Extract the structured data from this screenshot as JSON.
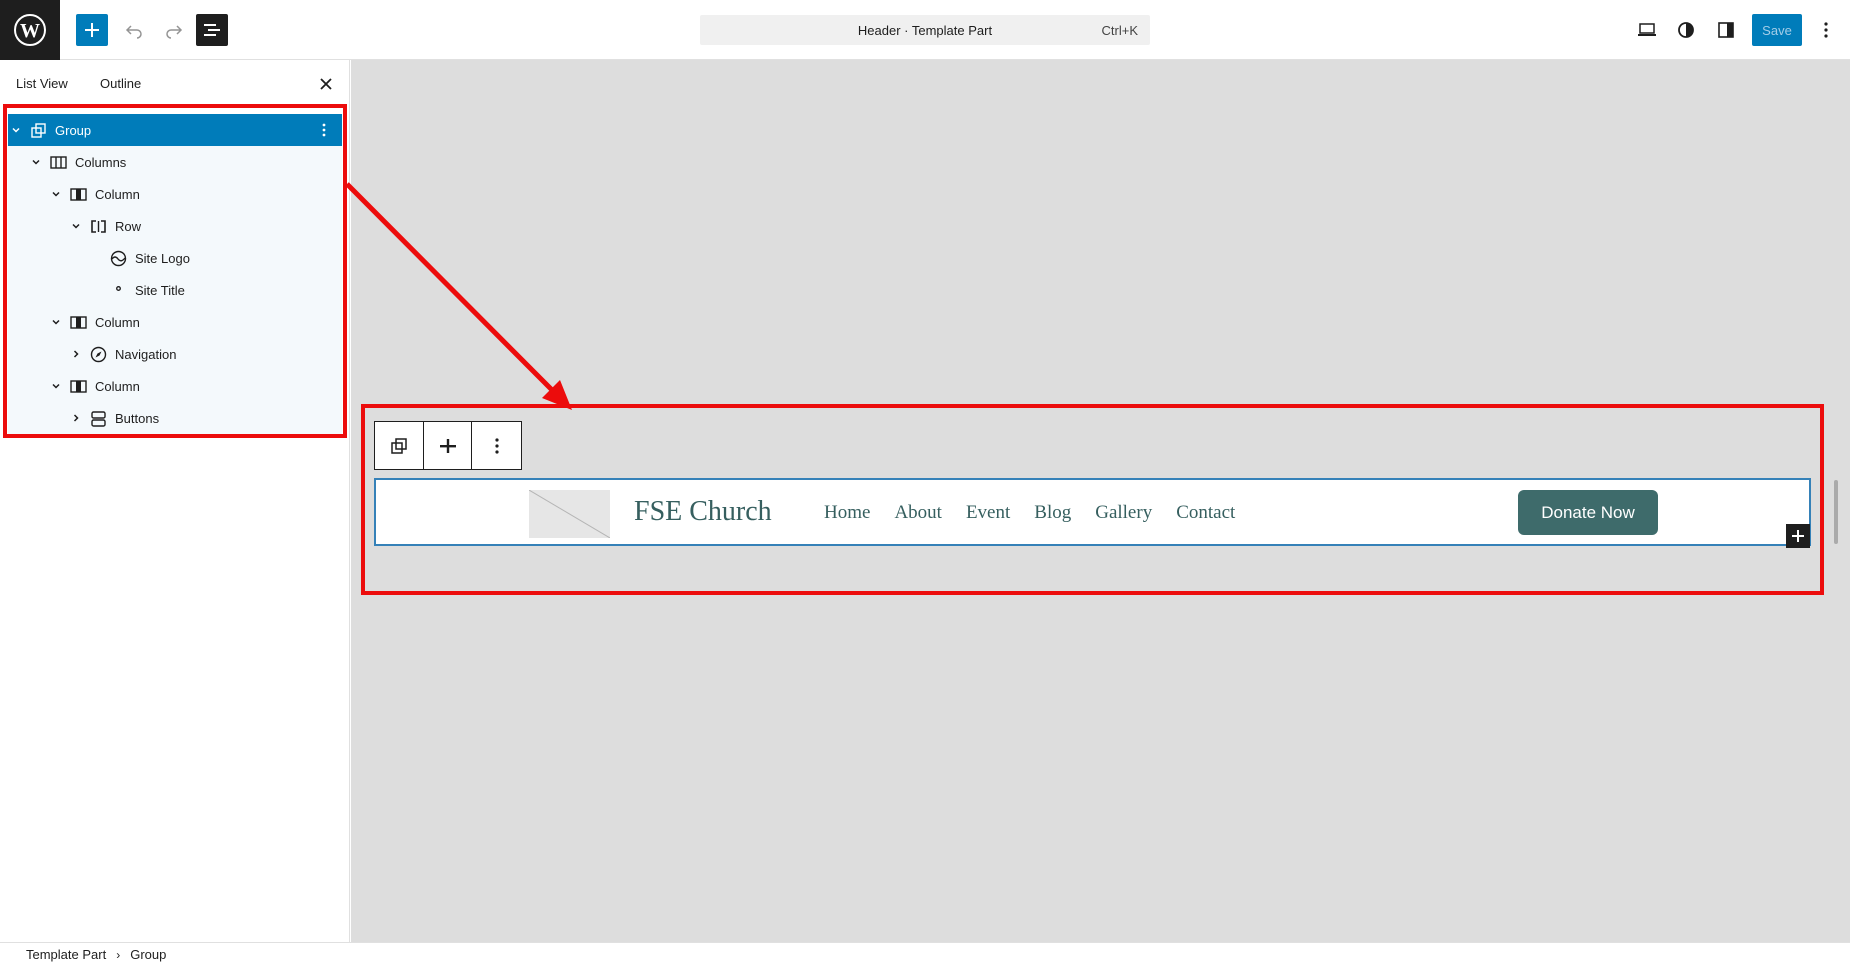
{
  "header": {
    "command_title": "Header · Template Part",
    "command_shortcut": "Ctrl+K",
    "save_label": "Save"
  },
  "sidebar": {
    "tabs": [
      {
        "label": "List View"
      },
      {
        "label": "Outline"
      }
    ],
    "tree": [
      {
        "label": "Group",
        "level": 0,
        "icon": "group-icon",
        "expanded": true,
        "selected": true
      },
      {
        "label": "Columns",
        "level": 1,
        "icon": "columns-icon",
        "expanded": true
      },
      {
        "label": "Column",
        "level": 2,
        "icon": "column-icon",
        "expanded": true
      },
      {
        "label": "Row",
        "level": 3,
        "icon": "row-icon",
        "expanded": true
      },
      {
        "label": "Site Logo",
        "level": 4,
        "icon": "site-logo-icon",
        "leaf": true
      },
      {
        "label": "Site Title",
        "level": 4,
        "icon": "site-title-icon",
        "leaf": true
      },
      {
        "label": "Column",
        "level": 2,
        "icon": "column-icon",
        "expanded": true
      },
      {
        "label": "Navigation",
        "level": 3,
        "icon": "navigation-icon",
        "expanded": false
      },
      {
        "label": "Column",
        "level": 2,
        "icon": "column-icon",
        "expanded": true
      },
      {
        "label": "Buttons",
        "level": 3,
        "icon": "buttons-icon",
        "expanded": false
      }
    ]
  },
  "canvas": {
    "site_title": "FSE Church",
    "nav_items": [
      "Home",
      "About",
      "Event",
      "Blog",
      "Gallery",
      "Contact"
    ],
    "donate_label": "Donate Now"
  },
  "footer": {
    "breadcrumbs": [
      "Template Part",
      "Group"
    ]
  },
  "colors": {
    "accent": "#007cba",
    "annotation": "#ec0c0c",
    "site_text": "#365f5f",
    "button_bg": "#3e6b6b"
  }
}
